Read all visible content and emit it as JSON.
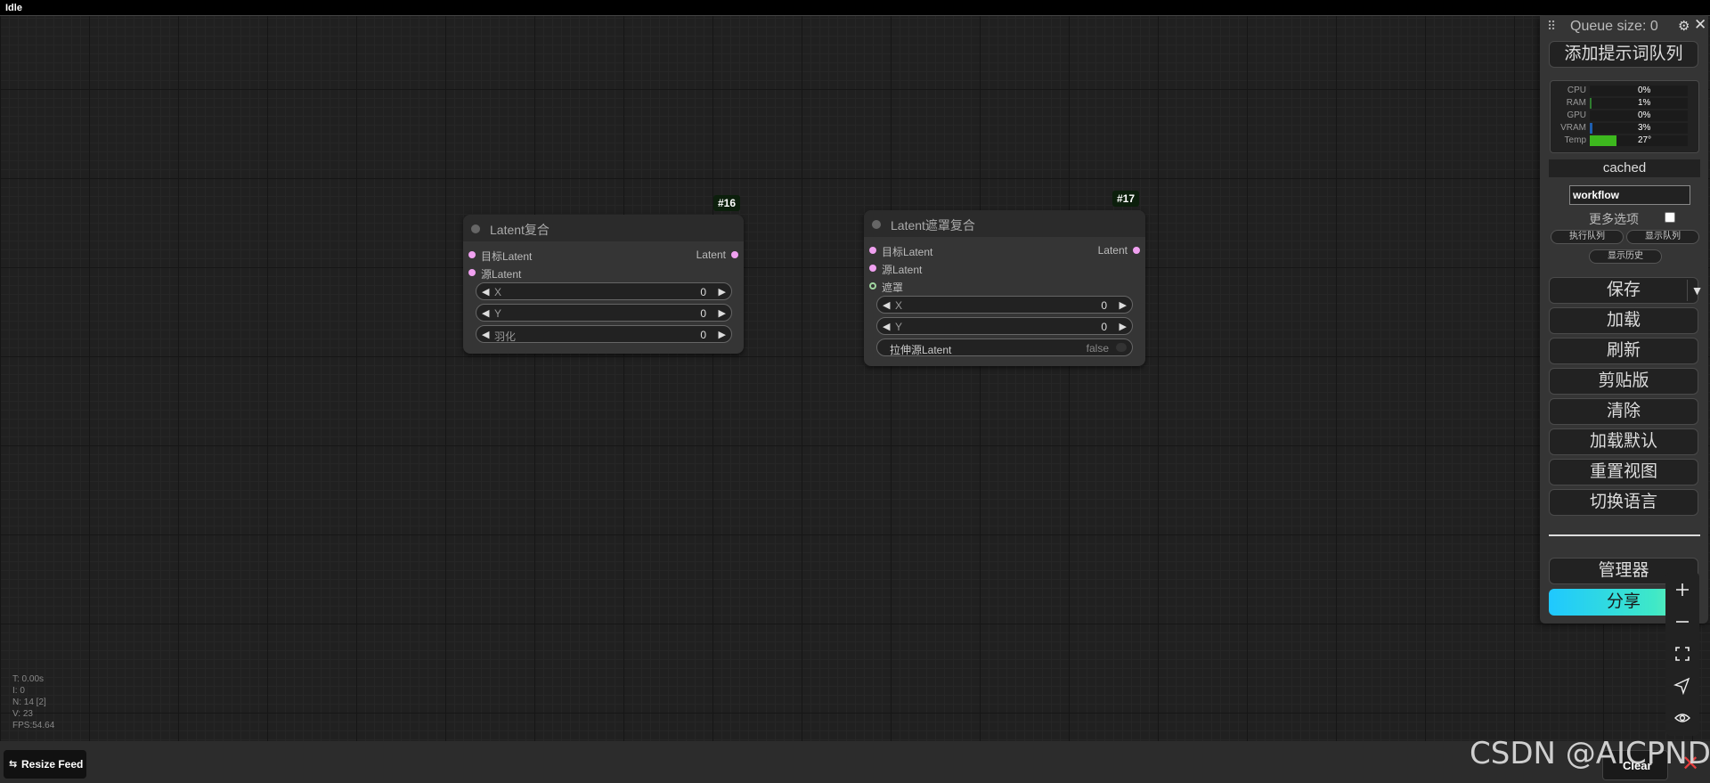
{
  "status": "Idle",
  "nodes": [
    {
      "id_badge": "#16",
      "title": "Latent复合",
      "inputs": [
        "目标Latent",
        "源Latent"
      ],
      "output": "Latent",
      "widgets": [
        {
          "name": "X",
          "value": "0"
        },
        {
          "name": "Y",
          "value": "0"
        },
        {
          "name": "羽化",
          "value": "0"
        }
      ]
    },
    {
      "id_badge": "#17",
      "title": "Latent遮罩复合",
      "inputs": [
        "目标Latent",
        "源Latent",
        "遮罩"
      ],
      "output": "Latent",
      "widgets": [
        {
          "name": "X",
          "value": "0"
        },
        {
          "name": "Y",
          "value": "0"
        }
      ],
      "toggle": {
        "name": "拉伸源Latent",
        "value": "false"
      }
    }
  ],
  "stats": [
    "T: 0.00s",
    "I: 0",
    "N: 14 [2]",
    "V: 23",
    "FPS:54.64"
  ],
  "menu": {
    "queue_size": "Queue size: 0",
    "queue_prompt": "添加提示词队列",
    "monitor": [
      {
        "label": "CPU",
        "value": "0%",
        "fill": 0.0,
        "color": "#2f7d2f"
      },
      {
        "label": "RAM",
        "value": "1%",
        "fill": 0.01,
        "color": "#2f7d2f"
      },
      {
        "label": "GPU",
        "value": "0%",
        "fill": 0.0,
        "color": "#2f7d2f"
      },
      {
        "label": "VRAM",
        "value": "3%",
        "fill": 0.03,
        "color": "#1e5fb0"
      },
      {
        "label": "Temp",
        "value": "27°",
        "fill": 0.27,
        "color": "#3db81e"
      }
    ],
    "cached": "cached",
    "workflow_value": "workflow",
    "more_options": "更多选项",
    "view_queue": "执行队列",
    "view_queue2": "显示队列",
    "view_history": "显示历史",
    "save": "保存",
    "load": "加载",
    "refresh": "刷新",
    "clipspace": "剪贴版",
    "clear": "清除",
    "load_default": "加载默认",
    "reset_view": "重置视图",
    "switch_lang": "切换语言",
    "manager": "管理器",
    "share": "分享"
  },
  "bottom": {
    "resize_feed": "Resize Feed",
    "clear": "Clear"
  },
  "watermark": "CSDN @AICPND"
}
